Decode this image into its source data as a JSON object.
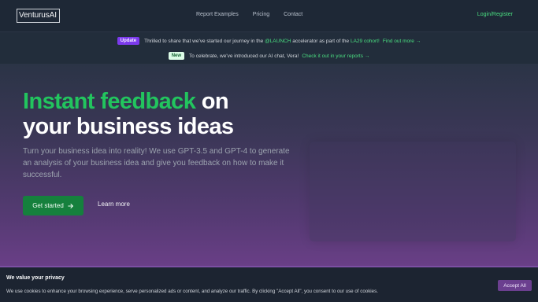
{
  "brand": {
    "logo": "VenturusAI"
  },
  "nav": {
    "links": [
      "Report Examples",
      "Pricing",
      "Contact"
    ],
    "login": "Login/Register"
  },
  "announcements": [
    {
      "badge": "Update",
      "text_before": "Thrilled to share that we've started our journey in the",
      "highlight1": "@LAUNCH",
      "text_middle": "accelerator as part of the",
      "highlight2": "LA29 cohort!",
      "link": "Find out more →"
    },
    {
      "badge": "New",
      "text": "To celebrate, we've introduced our AI chat, Vera! ",
      "link": "Check it out in your reports →"
    }
  ],
  "hero": {
    "headline_accent": "Instant feedback",
    "headline_rest_1": " on",
    "headline_line_2": "your business ideas",
    "subtext": "Turn your business idea into reality! We use GPT-3.5 and GPT-4 to generate an analysis of your business idea and give you feedback on how to make it successful.",
    "primary_button": "Get started",
    "primary_button_icon": "arrow-right-icon",
    "secondary_button": "Learn more"
  },
  "cookie_banner": {
    "title": "We value your privacy",
    "text": "We use cookies to enhance your browsing experience, serve personalized ads or content, and analyze our traffic. By clicking \"Accept All\", you consent to our use of cookies.",
    "accept_button": "Accept All"
  },
  "colors": {
    "accent_green": "#22c55e",
    "primary_button": "#15803d",
    "update_badge": "#7c3aed",
    "new_badge": "#dcfce7",
    "cookie_accept": "#6b3f8f"
  }
}
